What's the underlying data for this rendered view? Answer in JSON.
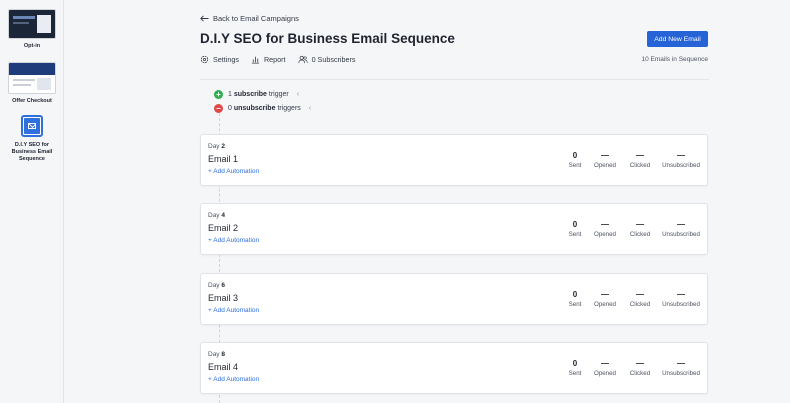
{
  "sidebar": {
    "steps": [
      {
        "label": "Opt-in",
        "thumb": "optin-page-thumbnail"
      },
      {
        "label": "Offer Checkout",
        "thumb": "checkout-page-thumbnail"
      },
      {
        "label": "D.I.Y SEO for Business Email Sequence",
        "thumb": "email-icon",
        "active": true
      }
    ]
  },
  "header": {
    "back_label": "Back to Email Campaigns",
    "title": "D.I.Y SEO for Business Email Sequence",
    "add_button": "Add New Email"
  },
  "toolbar": {
    "settings": "Settings",
    "report": "Report",
    "subscribers": "0 Subscribers",
    "emails_count": "10 Emails in Sequence"
  },
  "triggers": {
    "subscribe_count": "1",
    "subscribe_word": "subscribe",
    "subscribe_suffix": "trigger",
    "unsubscribe_count": "0",
    "unsubscribe_word": "unsubscribe",
    "unsubscribe_suffix": "triggers"
  },
  "stat_labels": {
    "sent": "Sent",
    "opened": "Opened",
    "clicked": "Clicked",
    "unsubscribed": "Unsubscribed"
  },
  "add_automation": "Add Automation",
  "day_prefix": "Day",
  "emails": [
    {
      "day": "2",
      "name": "Email 1",
      "sent": "0",
      "opened": "—",
      "clicked": "—",
      "unsubscribed": "—"
    },
    {
      "day": "4",
      "name": "Email 2",
      "sent": "0",
      "opened": "—",
      "clicked": "—",
      "unsubscribed": "—"
    },
    {
      "day": "6",
      "name": "Email 3",
      "sent": "0",
      "opened": "—",
      "clicked": "—",
      "unsubscribed": "—"
    },
    {
      "day": "8",
      "name": "Email 4",
      "sent": "0",
      "opened": "—",
      "clicked": "—",
      "unsubscribed": "—"
    }
  ],
  "colors": {
    "accent": "#2563d6",
    "success": "#2fae4e",
    "danger": "#e04848"
  }
}
